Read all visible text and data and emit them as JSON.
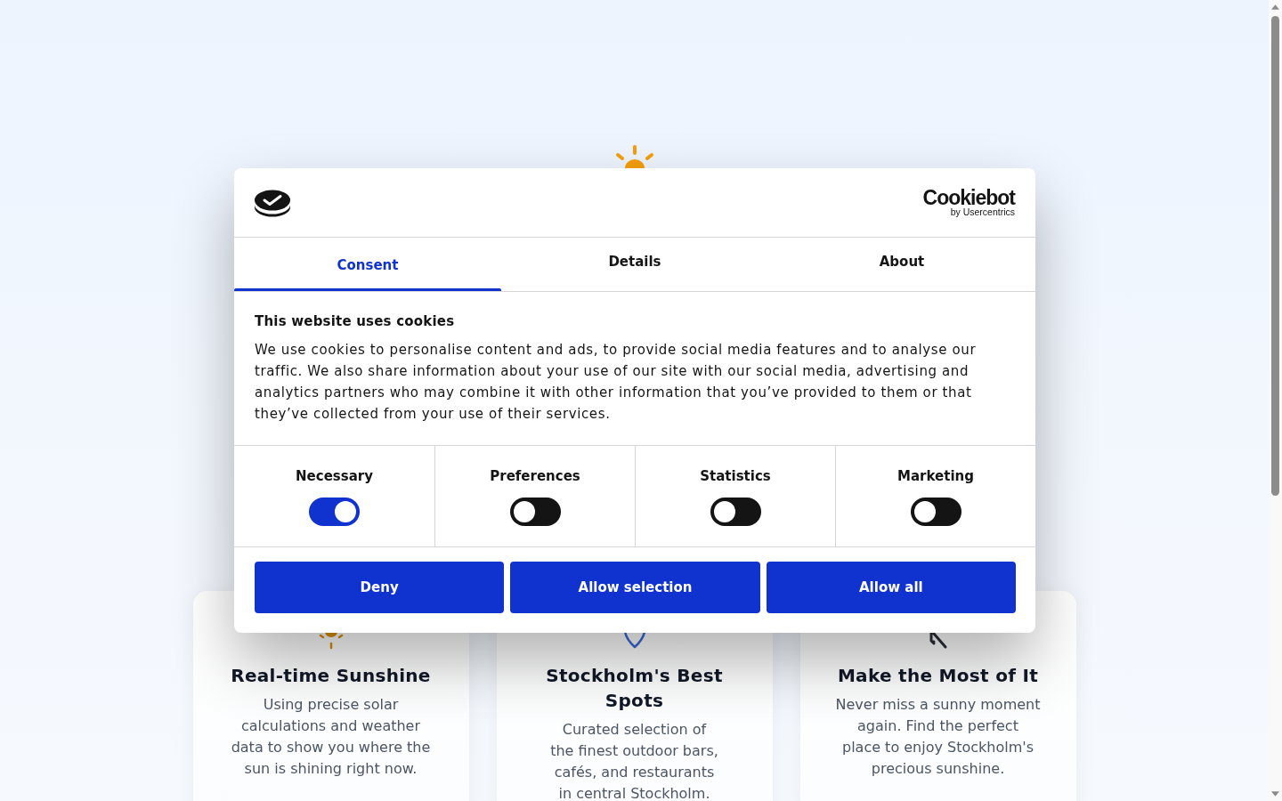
{
  "page": {
    "features": [
      {
        "title": "Real-time Sunshine",
        "description": "Using precise solar calculations and weather data to show you where the sun is shining right now."
      },
      {
        "title": "Stockholm's Best Spots",
        "description": "Curated selection of the finest outdoor bars, cafés, and restaurants in central Stockholm."
      },
      {
        "title": "Make the Most of It",
        "description": "Never miss a sunny moment again. Find the perfect place to enjoy Stockholm's precious sunshine."
      }
    ]
  },
  "cookie_dialog": {
    "brand": {
      "name": "Cookiebot",
      "tagline": "by Usercentrics"
    },
    "tabs": [
      {
        "label": "Consent",
        "selected": true
      },
      {
        "label": "Details",
        "selected": false
      },
      {
        "label": "About",
        "selected": false
      }
    ],
    "title": "This website uses cookies",
    "body": "We use cookies to personalise content and ads, to provide social media features and to analyse our traffic. We also share information about your use of our site with our social media, advertising and analytics partners who may combine it with other information that you’ve provided to them or that they’ve collected from your use of their services.",
    "categories": [
      {
        "label": "Necessary",
        "on": true
      },
      {
        "label": "Preferences",
        "on": false
      },
      {
        "label": "Statistics",
        "on": false
      },
      {
        "label": "Marketing",
        "on": false
      }
    ],
    "buttons": [
      "Deny",
      "Allow selection",
      "Allow all"
    ]
  }
}
